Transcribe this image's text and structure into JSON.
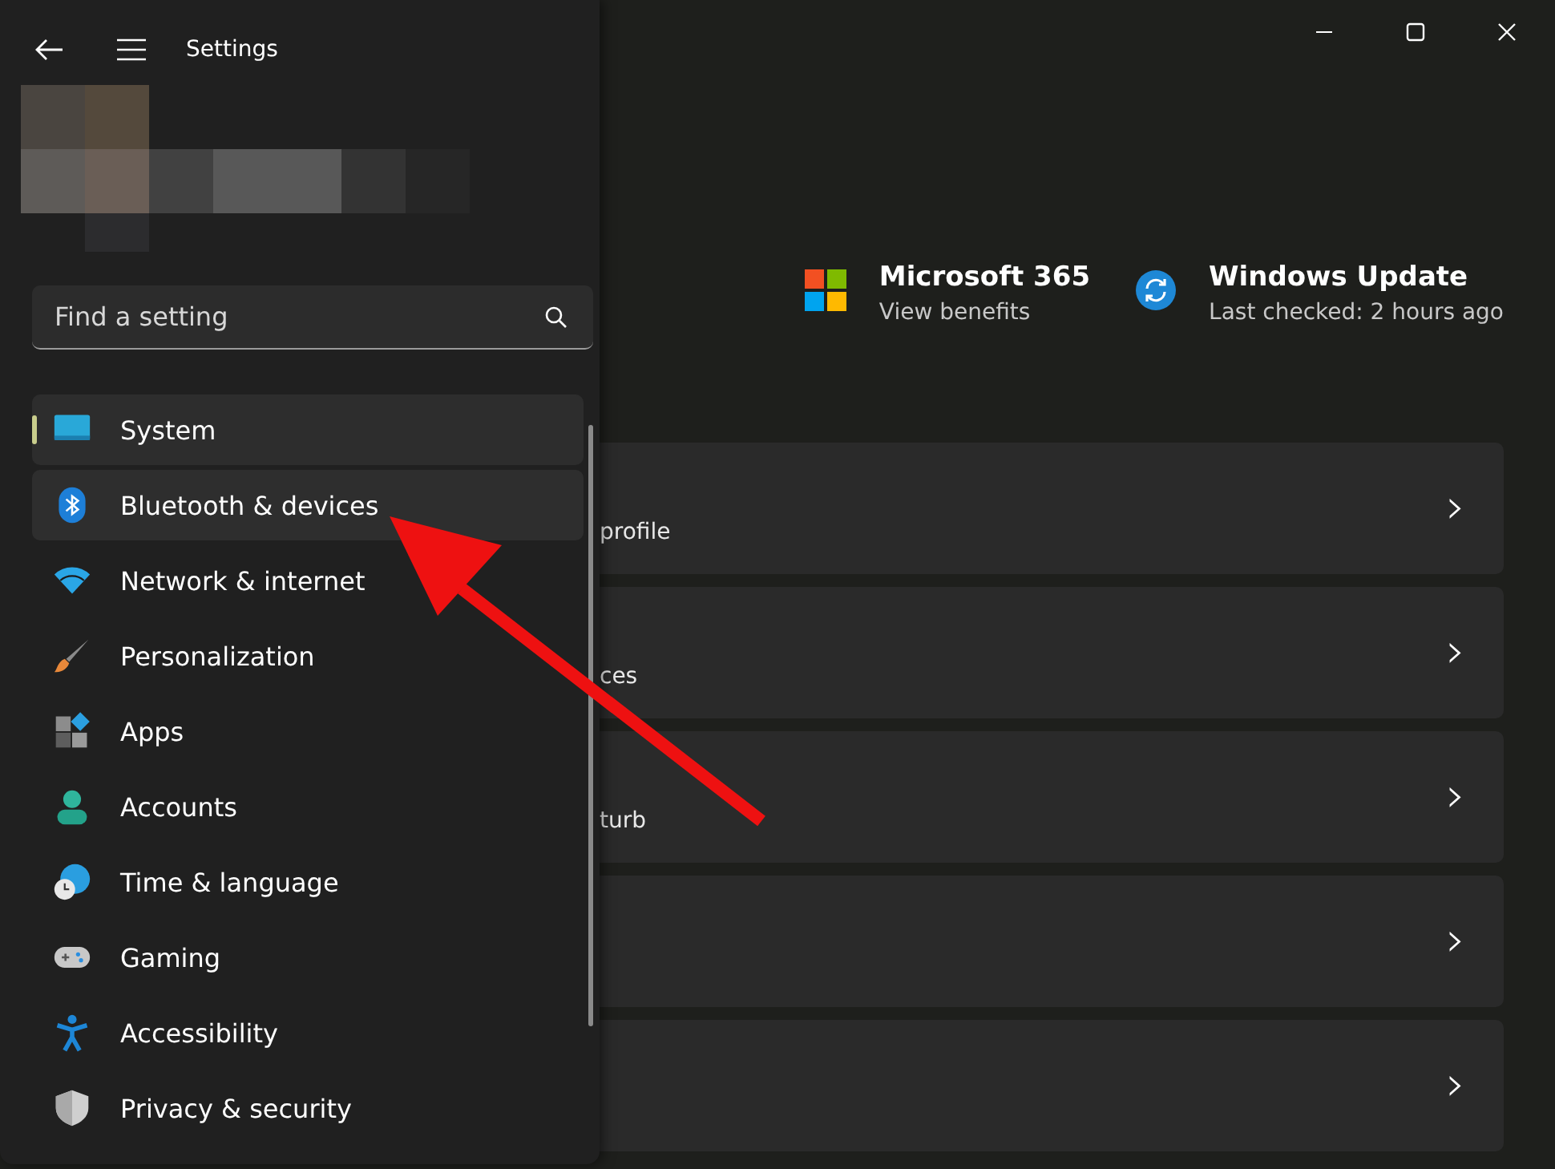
{
  "window": {
    "title": "Settings"
  },
  "search": {
    "placeholder": "Find a setting"
  },
  "nav_items": [
    {
      "label": "System",
      "selected": true,
      "hovered": false
    },
    {
      "label": "Bluetooth & devices",
      "selected": false,
      "hovered": true
    },
    {
      "label": "Network & internet",
      "selected": false,
      "hovered": false
    },
    {
      "label": "Personalization",
      "selected": false,
      "hovered": false
    },
    {
      "label": "Apps",
      "selected": false,
      "hovered": false
    },
    {
      "label": "Accounts",
      "selected": false,
      "hovered": false
    },
    {
      "label": "Time & language",
      "selected": false,
      "hovered": false
    },
    {
      "label": "Gaming",
      "selected": false,
      "hovered": false
    },
    {
      "label": "Accessibility",
      "selected": false,
      "hovered": false
    },
    {
      "label": "Privacy & security",
      "selected": false,
      "hovered": false
    }
  ],
  "promos": [
    {
      "kind": "microsoft365",
      "title": "Microsoft 365",
      "subtitle": "View benefits"
    },
    {
      "kind": "update",
      "title": "Windows Update",
      "subtitle": "Last checked: 2 hours ago"
    }
  ],
  "cards": [
    {
      "text": "profile",
      "chevron": "›"
    },
    {
      "text": "ces",
      "chevron": "›"
    },
    {
      "text": "turb",
      "chevron": "›"
    },
    {
      "chevron": "›"
    },
    {
      "chevron": "›"
    }
  ]
}
